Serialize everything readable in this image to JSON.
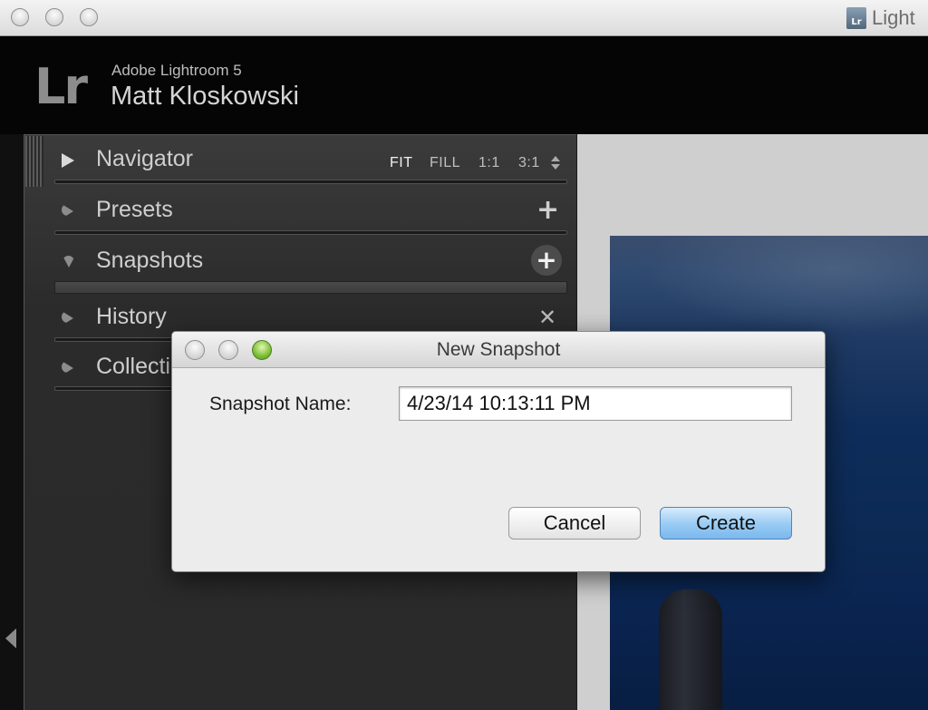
{
  "window": {
    "title": "Light",
    "doc_icon": "Lr"
  },
  "identity": {
    "logo": "Lr",
    "app_name": "Adobe Lightroom 5",
    "user_name": "Matt Kloskowski"
  },
  "panel": {
    "navigator": {
      "label": "Navigator",
      "zoom": [
        "FIT",
        "FILL",
        "1:1",
        "3:1"
      ],
      "active_zoom": "FIT"
    },
    "presets": {
      "label": "Presets"
    },
    "snapshots": {
      "label": "Snapshots"
    },
    "history": {
      "label": "History"
    },
    "collections": {
      "label": "Collections"
    }
  },
  "dialog": {
    "title": "New Snapshot",
    "name_label": "Snapshot Name:",
    "name_value": "4/23/14 10:13:11 PM",
    "cancel_label": "Cancel",
    "create_label": "Create"
  },
  "icons": {
    "plus": "+",
    "close": "✕"
  },
  "colors": {
    "panel_bg": "#2b2b2b",
    "default_button": "#9ccdf4",
    "zoom_button_green": "#7cbf35"
  }
}
